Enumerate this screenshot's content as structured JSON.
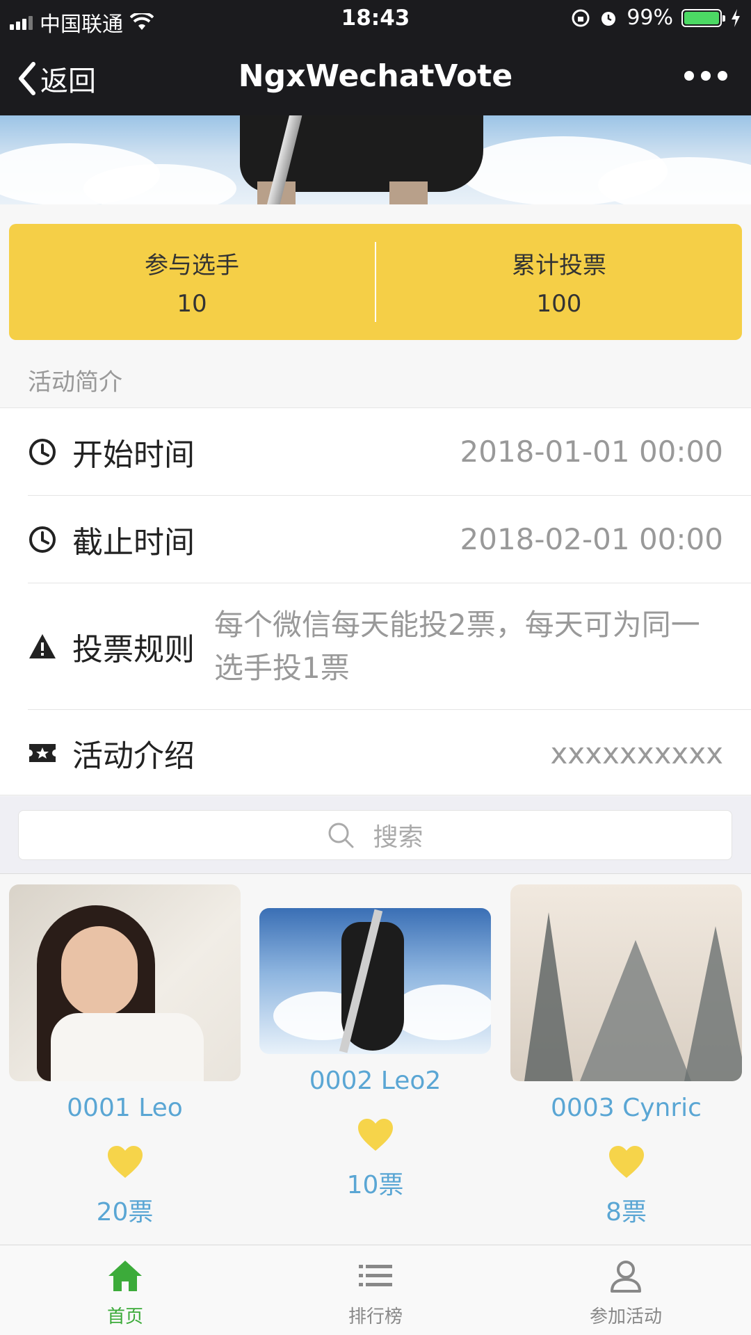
{
  "status_bar": {
    "carrier": "中国联通",
    "time": "18:43",
    "battery": "99%",
    "battery_level": 0.99
  },
  "nav": {
    "back_label": "返回",
    "title": "NgxWechatVote"
  },
  "stats": [
    {
      "label": "参与选手",
      "value": "10"
    },
    {
      "label": "累计投票",
      "value": "100"
    }
  ],
  "intro": {
    "section_title": "活动简介",
    "rows": [
      {
        "icon": "clock-icon",
        "label": "开始时间",
        "value": "2018-01-01 00:00"
      },
      {
        "icon": "clock-icon",
        "label": "截止时间",
        "value": "2018-02-01 00:00"
      },
      {
        "icon": "warning-icon",
        "label": "投票规则",
        "value": "每个微信每天能投2票，每天可为同一选手投1票"
      },
      {
        "icon": "ticket-icon",
        "label": "活动介绍",
        "value": "xxxxxxxxxx"
      }
    ]
  },
  "search": {
    "placeholder": "搜索"
  },
  "players": [
    {
      "name": "0001 Leo",
      "votes": "20票"
    },
    {
      "name": "0002 Leo2",
      "votes": "10票"
    },
    {
      "name": "0003 Cynric",
      "votes": "8票"
    }
  ],
  "tabbar": {
    "tabs": [
      {
        "label": "首页",
        "icon": "home-icon",
        "active": true
      },
      {
        "label": "排行榜",
        "icon": "list-icon",
        "active": false
      },
      {
        "label": "参加活动",
        "icon": "user-icon",
        "active": false
      }
    ]
  },
  "colors": {
    "accent_green": "#3cab3a",
    "stats_yellow": "#f5cf47",
    "link_blue": "#5aa6d4",
    "heart_yellow": "#f6d44a",
    "bar_dark": "#1b1b1e"
  }
}
